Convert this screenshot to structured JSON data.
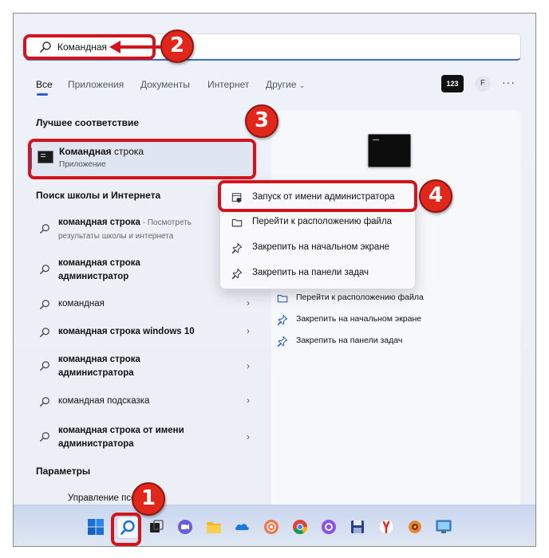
{
  "search": {
    "query": "Командная"
  },
  "tabs": {
    "all": "Все",
    "apps": "Приложения",
    "documents": "Документы",
    "web": "Интернет",
    "more": "Другие"
  },
  "header": {
    "points_badge": "123",
    "avatar_initial": "F",
    "more": "···"
  },
  "sections": {
    "best_match": "Лучшее соответствие",
    "web_search": "Поиск школы и Интернета",
    "settings": "Параметры"
  },
  "best_match": {
    "title_bold": "Командная",
    "title_rest": " строка",
    "subtitle": "Приложение"
  },
  "suggestions": [
    {
      "bold": "командная строка",
      "rest": " - Посмотреть результаты школы и интернета"
    },
    {
      "bold": "командная строка администратор",
      "rest": ""
    },
    {
      "bold": "",
      "rest": "командная"
    },
    {
      "bold": "командная строка windows 10",
      "rest": ""
    },
    {
      "bold": "командная строка администратора",
      "rest": ""
    },
    {
      "bold": "",
      "rest": "командная подсказка"
    },
    {
      "bold": "командная строка от имени администратора",
      "rest": ""
    }
  ],
  "settings_item": "Управление псевдо...",
  "context_menu": [
    {
      "label": "Запуск от имени администратора",
      "icon": "shield-icon"
    },
    {
      "label": "Перейти к расположению файла",
      "icon": "folder-icon"
    },
    {
      "label": "Закрепить на начальном экране",
      "icon": "pin-icon"
    },
    {
      "label": "Закрепить на панели задач",
      "icon": "pin-icon"
    }
  ],
  "preview_actions": [
    {
      "label": "Перейти к расположению файла",
      "icon": "folder-icon"
    },
    {
      "label": "Закрепить на начальном экране",
      "icon": "pin-icon"
    },
    {
      "label": "Закрепить на панели задач",
      "icon": "pin-icon"
    }
  ],
  "callouts": [
    "1",
    "2",
    "3",
    "4"
  ],
  "colors": {
    "accent": "#2a63c9",
    "callout_red": "#e1261c"
  }
}
